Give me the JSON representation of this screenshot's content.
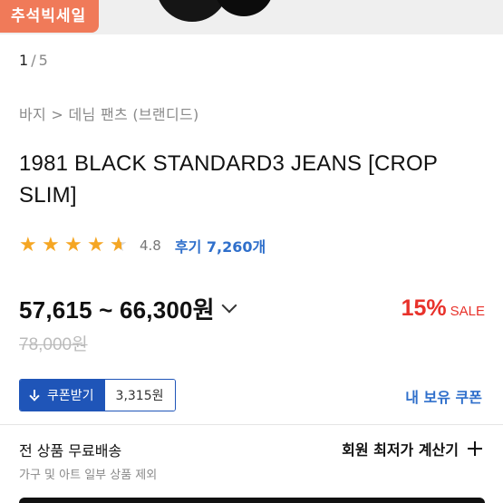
{
  "hero": {
    "sale_tag": "추석빅세일"
  },
  "pager": {
    "current": "1",
    "separator": "/",
    "total": "5"
  },
  "breadcrumb": "바지 > 데님 팬츠 (브랜디드)",
  "product": {
    "title": "1981 BLACK STANDARD3 JEANS [CROP SLIM]",
    "rating": {
      "value": "4.8",
      "stars_filled": 4.8,
      "star_color": "#f5a623",
      "review_label": "후기 7,260개"
    },
    "price": {
      "range": "57,615 ~ 66,300원",
      "discount_percent": "15%",
      "sale_label": "SALE",
      "discount_color": "#e8322b",
      "original": "78,000원"
    }
  },
  "coupon": {
    "button_label": "쿠폰받기",
    "amount": "3,315원",
    "my_coupon_label": "내 보유 쿠폰",
    "accent": "#1f55b8"
  },
  "shipping": {
    "title": "전 상품 무료배송",
    "subtitle": "가구 및 아트 일부 상품 제외",
    "calc_label": "회원 최저가 계산기"
  },
  "icons": {
    "expand": "chevron-down-icon",
    "download": "download-icon",
    "plus": "plus-icon",
    "star": "star-icon"
  }
}
